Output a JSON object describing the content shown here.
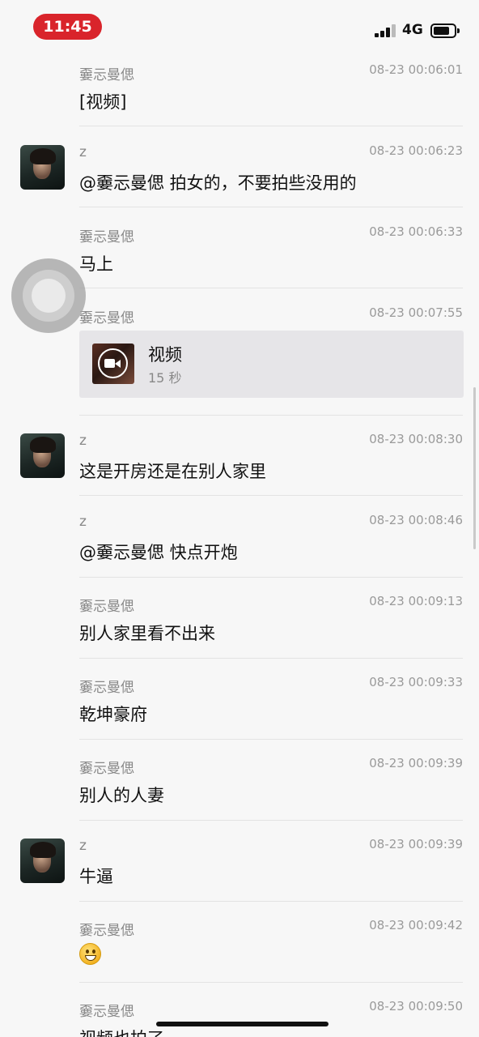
{
  "status_bar": {
    "time": "11:45",
    "network": "4G"
  },
  "video_card": {
    "title": "视频",
    "duration": "15 秒"
  },
  "messages": [
    {
      "sender": "嫑忈曼偲",
      "time": "08-23 00:06:01",
      "text": "[视频]"
    },
    {
      "sender": "z",
      "time": "08-23 00:06:23",
      "text": "@嫑忈曼偲 拍女的，不要拍些没用的"
    },
    {
      "sender": "嫑忈曼偲",
      "time": "08-23 00:06:33",
      "text": "马上"
    },
    {
      "sender": "嫑忈曼偲",
      "time": "08-23 00:07:55",
      "text": ""
    },
    {
      "sender": "z",
      "time": "08-23 00:08:30",
      "text": "这是开房还是在别人家里"
    },
    {
      "sender": "z",
      "time": "08-23 00:08:46",
      "text": "@嫑忈曼偲 快点开炮"
    },
    {
      "sender": "嫑忈曼偲",
      "time": "08-23 00:09:13",
      "text": "别人家里看不出来"
    },
    {
      "sender": "嫑忈曼偲",
      "time": "08-23 00:09:33",
      "text": "乾坤豪府"
    },
    {
      "sender": "嫑忈曼偲",
      "time": "08-23 00:09:39",
      "text": "别人的人妻"
    },
    {
      "sender": "z",
      "time": "08-23 00:09:39",
      "text": "牛逼"
    },
    {
      "sender": "嫑忈曼偲",
      "time": "08-23 00:09:42",
      "text": ""
    },
    {
      "sender": "嫑忈曼偲",
      "time": "08-23 00:09:50",
      "text": "视频也拍了"
    }
  ]
}
